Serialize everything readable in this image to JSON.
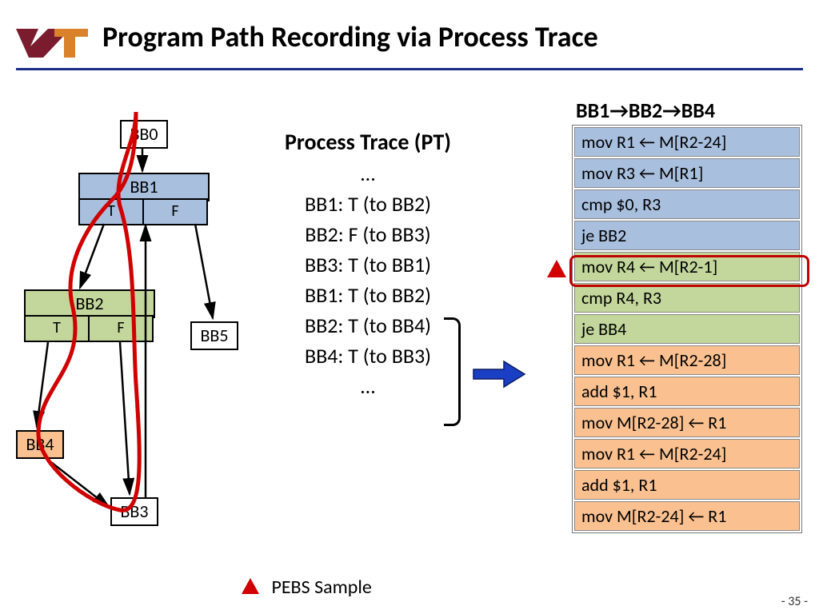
{
  "title": "Program Path Recording via Process Trace",
  "logo_label": "VT",
  "cfg": {
    "bb0": "BB0",
    "bb1": "BB1",
    "bb1_t": "T",
    "bb1_f": "F",
    "bb2": "BB2",
    "bb2_t": "T",
    "bb2_f": "F",
    "bb3": "BB3",
    "bb4": "BB4",
    "bb5": "BB5"
  },
  "pt": {
    "title": "Process Trace (PT)",
    "lines": [
      "…",
      "BB1: T (to BB2)",
      "BB2: F (to BB3)",
      "BB3: T (to BB1)",
      "BB1: T (to BB2)",
      "BB2: T (to BB4)",
      "BB4: T (to BB3)",
      "…"
    ]
  },
  "asm": {
    "path_header": "BB1→BB2→BB4",
    "blocks": [
      {
        "color": "blue",
        "lines": [
          "mov R1 ← M[R2-24]",
          "mov R3 ← M[R1]",
          "cmp $0, R3",
          "je BB2"
        ]
      },
      {
        "color": "green",
        "lines": [
          "mov R4 ← M[R2-1]",
          "cmp R4, R3",
          "je BB4"
        ]
      },
      {
        "color": "orange",
        "lines": [
          "mov R1 ← M[R2-28]",
          "add $1, R1",
          "mov M[R2-28] ← R1",
          "mov R1 ← M[R2-24]",
          "add $1, R1",
          "mov M[R2-24] ← R1"
        ]
      }
    ],
    "highlighted_line": "mov R4 ← M[R2-1]"
  },
  "legend": "PEBS Sample",
  "page_number": "- 35 -"
}
